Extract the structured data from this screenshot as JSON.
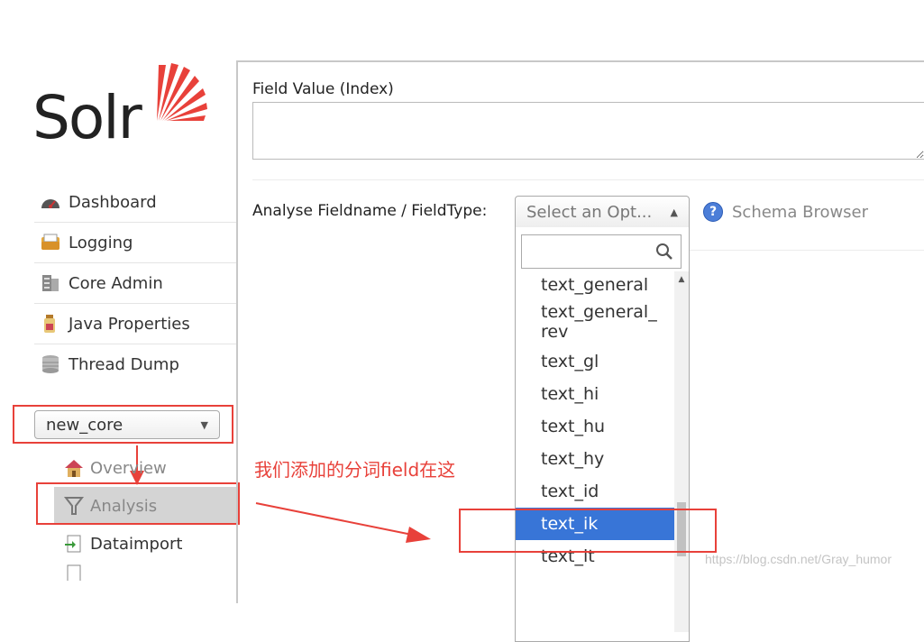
{
  "brand": {
    "name": "Solr"
  },
  "nav": {
    "items": [
      {
        "label": "Dashboard",
        "icon": "dashboard-icon"
      },
      {
        "label": "Logging",
        "icon": "logging-icon"
      },
      {
        "label": "Core Admin",
        "icon": "core-admin-icon"
      },
      {
        "label": "Java Properties",
        "icon": "java-properties-icon"
      },
      {
        "label": "Thread Dump",
        "icon": "thread-dump-icon"
      }
    ]
  },
  "core_selector": {
    "value": "new_core"
  },
  "core_menu": {
    "items": [
      {
        "label": "Overview",
        "icon": "overview-icon"
      },
      {
        "label": "Analysis",
        "icon": "analysis-icon",
        "active": true
      },
      {
        "label": "Dataimport",
        "icon": "dataimport-icon"
      }
    ]
  },
  "analysis": {
    "field_value_label": "Field Value (Index)",
    "fieldtype_label": "Analyse Fieldname / FieldType:",
    "select_placeholder": "Select an Opt...",
    "schema_browser_label": "Schema Browser",
    "dropdown_options": [
      "text_general",
      "text_general_rev",
      "text_gl",
      "text_hi",
      "text_hu",
      "text_hy",
      "text_id",
      "text_ik",
      "text_it"
    ],
    "highlighted_option": "text_ik"
  },
  "annotation": {
    "text": "我们添加的分词field在这"
  },
  "watermark": {
    "text": "https://blog.csdn.net/Gray_humor"
  },
  "colors": {
    "highlight": "#3875d7",
    "annotation_red": "#e8413a",
    "logo_orange": "#e8413a"
  }
}
